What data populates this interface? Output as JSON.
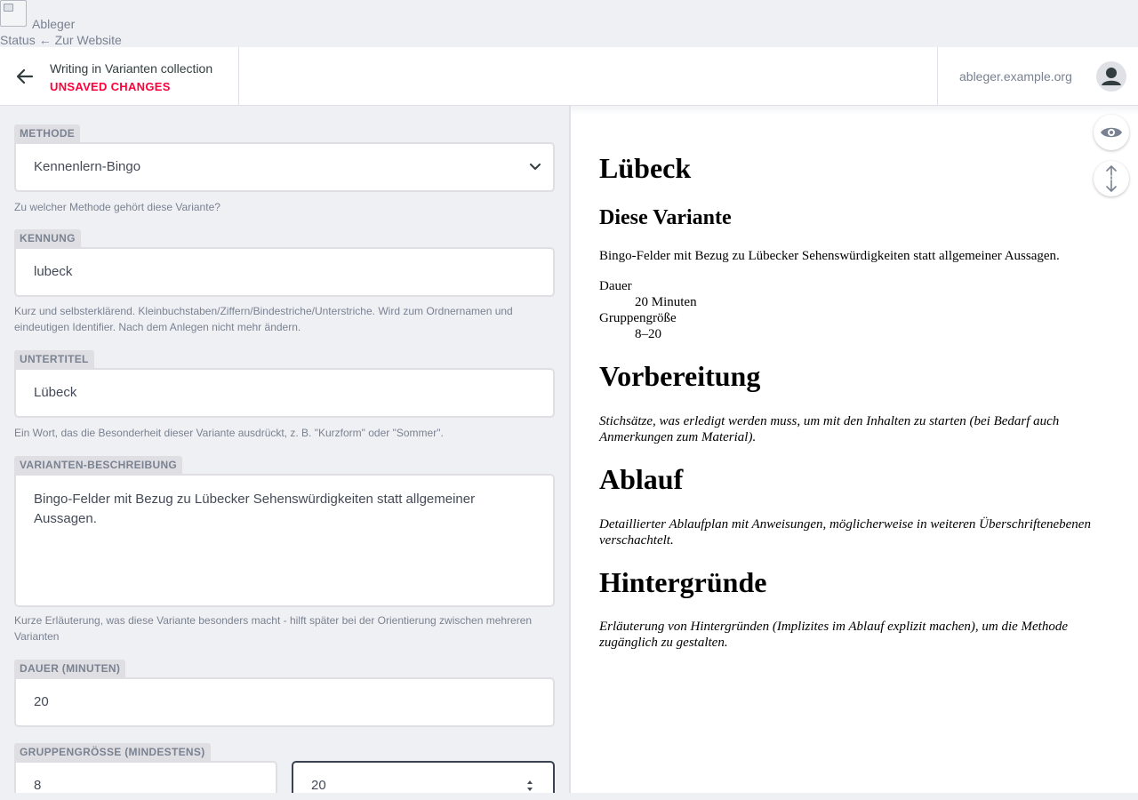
{
  "topbar": {
    "site_name": "Ableger",
    "status_link": "Status",
    "website_link": "← Zur Website"
  },
  "header": {
    "entry_title": "Writing in Varianten collection",
    "unsaved": "UNSAVED CHANGES",
    "site_url": "ableger.example.org"
  },
  "form": {
    "methode": {
      "label": "Methode",
      "value": "Kennenlern-Bingo",
      "hint": "Zu welcher Methode gehört diese Variante?"
    },
    "kennung": {
      "label": "Kennung",
      "value": "lubeck",
      "hint": "Kurz und selbsterklärend. Kleinbuchstaben/Ziffern/Bindestriche/Unterstriche. Wird zum Ordnernamen und eindeutigen Identifier. Nach dem Anlegen nicht mehr ändern."
    },
    "untertitel": {
      "label": "Untertitel",
      "value": "Lübeck",
      "hint": "Ein Wort, das die Besonderheit dieser Variante ausdrückt, z. B. \"Kurzform\" oder \"Sommer\"."
    },
    "beschreibung": {
      "label": "Varianten-Beschreibung",
      "value": "Bingo-Felder mit Bezug zu Lübecker Sehenswürdigkeiten statt allgemeiner Aussagen.",
      "hint": "Kurze Erläuterung, was diese Variante besonders macht - hilft später bei der Orientierung zwischen mehreren Varianten"
    },
    "dauer": {
      "label": "Dauer (Minuten)",
      "value": "20"
    },
    "gruppe": {
      "label": "Gruppengrösse (mindestens)",
      "min": "8",
      "max": "20"
    }
  },
  "preview": {
    "title": "Lübeck",
    "section_variant": "Diese Variante",
    "variant_text": "Bingo-Felder mit Bezug zu Lübecker Sehenswürdigkeiten statt allgemeiner Aussagen.",
    "dauer_term": "Dauer",
    "dauer_value": "20 Minuten",
    "gruppe_term": "Gruppengröße",
    "gruppe_value": "8–20",
    "vorbereitung_title": "Vorbereitung",
    "vorbereitung_text": "Stichsätze, was erledigt werden muss, um mit den Inhalten zu starten (bei Bedarf auch Anmerkungen zum Material).",
    "ablauf_title": "Ablauf",
    "ablauf_text": "Detaillierter Ablaufplan mit Anweisungen, möglicherweise in weiteren Überschriftenebenen verschachtelt.",
    "hintergruende_title": "Hintergründe",
    "hintergruende_text": "Erläuterung von Hintergründen (Implizites im Ablauf explizit machen), um die Methode zugänglich zu gestalten."
  },
  "icons": {
    "back": "arrow-left-icon",
    "avatar": "user-avatar-icon",
    "preview_toggle": "eye-icon",
    "sync_scroll": "scroll-sync-icon"
  },
  "colors": {
    "unsaved": "#ff003b",
    "label_bg": "#dfdfe3",
    "background": "#eff0f4"
  }
}
